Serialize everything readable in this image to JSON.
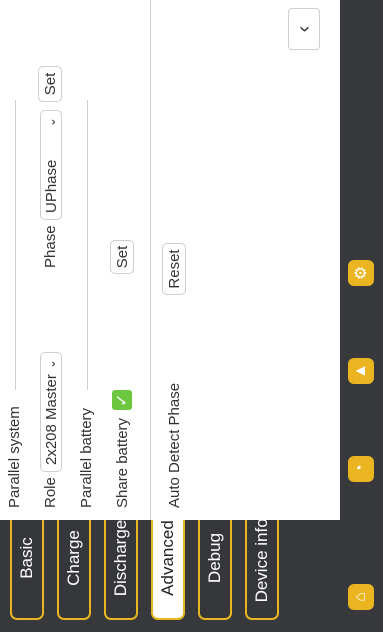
{
  "tabs": [
    {
      "label": "Basic"
    },
    {
      "label": "Charge"
    },
    {
      "label": "Discharge"
    },
    {
      "label": "Advanced"
    },
    {
      "label": "Debug"
    },
    {
      "label": "Device info."
    }
  ],
  "parallel_system": {
    "section_title": "Parallel system",
    "role_label": "Role",
    "role_value": "2x208 Master",
    "phase_label": "Phase",
    "phase_value": "UPhase",
    "set_label": "Set"
  },
  "parallel_battery": {
    "section_title": "Parallel battery",
    "share_label": "Share battery",
    "set_label": "Set"
  },
  "auto_detect": {
    "label": "Auto Detect Phase",
    "reset_label": "Reset"
  },
  "icons": [
    "home-icon",
    "clock-icon",
    "bell-icon",
    "gear-icon"
  ],
  "colors": {
    "accent": "#e9b61f",
    "check": "#6cc640",
    "background": "#37393d"
  }
}
